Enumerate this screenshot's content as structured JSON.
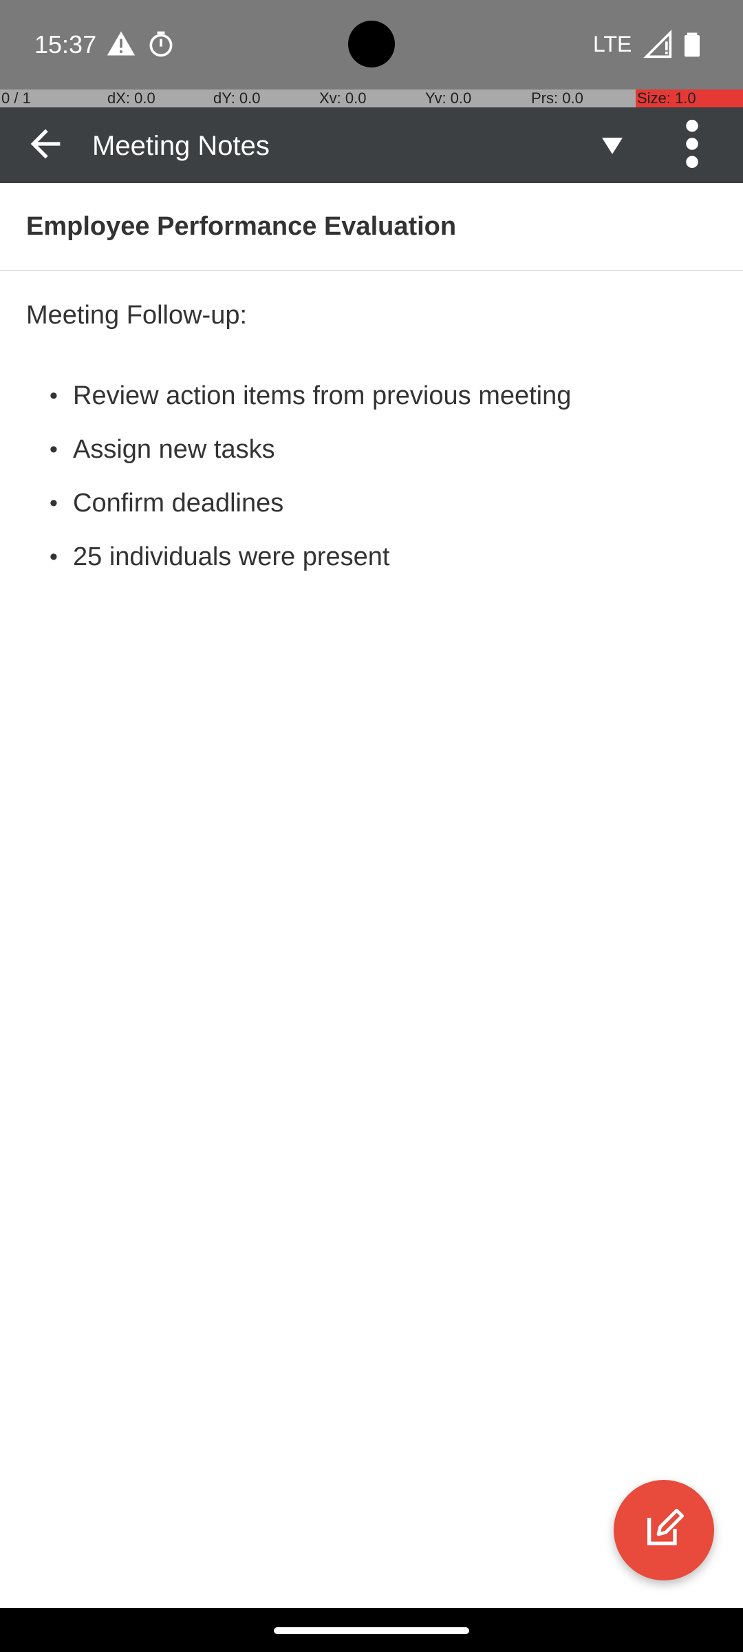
{
  "status_bar": {
    "time": "15:37",
    "network": "LTE",
    "icons": [
      "warning-icon",
      "timer-icon",
      "signal-icon",
      "battery-icon"
    ]
  },
  "debug_bar": {
    "pointer": "0 / 1",
    "dx": "dX: 0.0",
    "dy": "dY: 0.0",
    "xv": "Xv: 0.0",
    "yv": "Yv: 0.0",
    "prs": "Prs: 0.0",
    "size": "Size: 1.0"
  },
  "toolbar": {
    "title": "Meeting Notes",
    "back_icon": "arrow-left-icon",
    "dropdown_icon": "triangle-down-icon",
    "more_icon": "more-vert-icon"
  },
  "note": {
    "title": "Employee Performance Evaluation",
    "heading": "Meeting Follow-up:",
    "bullets": [
      "Review action items from previous meeting",
      "Assign new tasks",
      "Confirm deadlines",
      "25 individuals were present"
    ],
    "bullet_symbol": "•"
  },
  "fab": {
    "icon": "edit-note-icon"
  },
  "colors": {
    "status_bar": "#7a7a7a",
    "toolbar": "#3c4043",
    "accent": "#e84a3b",
    "text": "#333333"
  }
}
